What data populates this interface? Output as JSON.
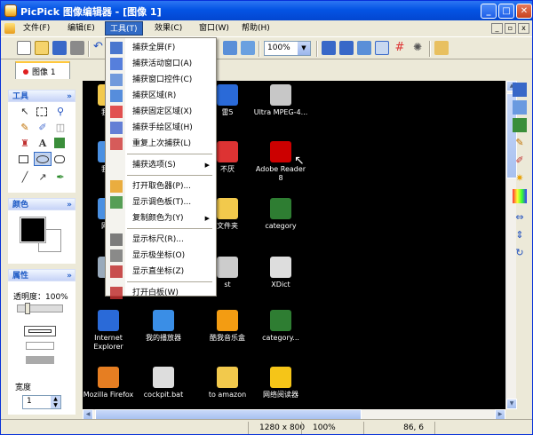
{
  "window": {
    "title": "PicPick 图像编辑器 - [图像 1]",
    "minimize": "_",
    "maximize": "□",
    "close": "✕"
  },
  "menubar": {
    "items": [
      {
        "label": "文件(F)"
      },
      {
        "label": "编辑(E)"
      },
      {
        "label": "工具(T)"
      },
      {
        "label": "效果(C)"
      },
      {
        "label": "窗口(W)"
      },
      {
        "label": "帮助(H)"
      }
    ],
    "mdi": {
      "minimize": "_",
      "restore": "▫",
      "close": "x"
    }
  },
  "toolbar": {
    "zoom": "100%"
  },
  "tabs": [
    {
      "label": "图像 1"
    }
  ],
  "tools_panel": {
    "title": "工具"
  },
  "color_panel": {
    "title": "颜色"
  },
  "props_panel": {
    "title": "属性",
    "opacity_label": "透明度：100%",
    "width_label": "宽度",
    "width_value": "1"
  },
  "menu": {
    "items": [
      {
        "label": "捕获全屏(F)",
        "icon": "fullscreen-icon"
      },
      {
        "label": "捕获活动窗口(A)",
        "icon": "window-icon"
      },
      {
        "label": "捕获窗口控件(C)",
        "icon": "control-icon"
      },
      {
        "label": "捕获区域(R)",
        "icon": "region-icon"
      },
      {
        "label": "捕获固定区域(X)",
        "icon": "fixed-region-icon"
      },
      {
        "label": "捕获手绘区域(H)",
        "icon": "freehand-icon"
      },
      {
        "label": "重复上次捕获(L)",
        "icon": "repeat-icon"
      },
      {
        "label": "捕获选项(S)",
        "icon": "",
        "submenu": true
      },
      {
        "label": "打开取色器(P)...",
        "icon": "color-picker-icon"
      },
      {
        "label": "显示调色板(T)...",
        "icon": "palette-icon"
      },
      {
        "label": "复制颜色为(Y)",
        "icon": "",
        "submenu": true
      },
      {
        "label": "显示标尺(R)...",
        "icon": "ruler-icon"
      },
      {
        "label": "显示极坐标(O)",
        "icon": "protractor-icon"
      },
      {
        "label": "显示直坐标(Z)",
        "icon": "crosshair-icon"
      },
      {
        "label": "打开白板(W)",
        "icon": "whiteboard-icon"
      }
    ]
  },
  "desktop": {
    "icons": [
      {
        "label": "我的",
        "color": "#f2c94c"
      },
      {
        "label": "雷5",
        "color": "#2a6ad8"
      },
      {
        "label": "Ultra MPEG-4...",
        "color": "#c7c7c7"
      },
      {
        "label": "我的",
        "color": "#4a90e2"
      },
      {
        "label": "不厌",
        "color": "#d33"
      },
      {
        "label": "Adobe Reader 8",
        "color": "#c00"
      },
      {
        "label": "网上",
        "color": "#4a90e2"
      },
      {
        "label": "文件夹",
        "color": "#f2c94c"
      },
      {
        "label": "category",
        "color": "#2e7d32"
      },
      {
        "label": "回",
        "color": "#9ab"
      },
      {
        "label": "st",
        "color": "#ccc"
      },
      {
        "label": "XDict",
        "color": "#ddd"
      },
      {
        "label": "Internet Explorer",
        "color": "#2a6ad8"
      },
      {
        "label": "我的播放器",
        "color": "#3a8ee6"
      },
      {
        "label": "酷我音乐盒",
        "color": "#f39c12"
      },
      {
        "label": "category...",
        "color": "#2e7d32"
      },
      {
        "label": "Mozilla Firefox",
        "color": "#e67e22"
      },
      {
        "label": "cockpit.bat",
        "color": "#ddd"
      },
      {
        "label": "to amazon",
        "color": "#f2c94c"
      },
      {
        "label": "网络阅读器",
        "color": "#f5c518"
      }
    ]
  },
  "statusbar": {
    "size": "1280 x 800",
    "zoom": "100%",
    "coords": "86, 6"
  }
}
